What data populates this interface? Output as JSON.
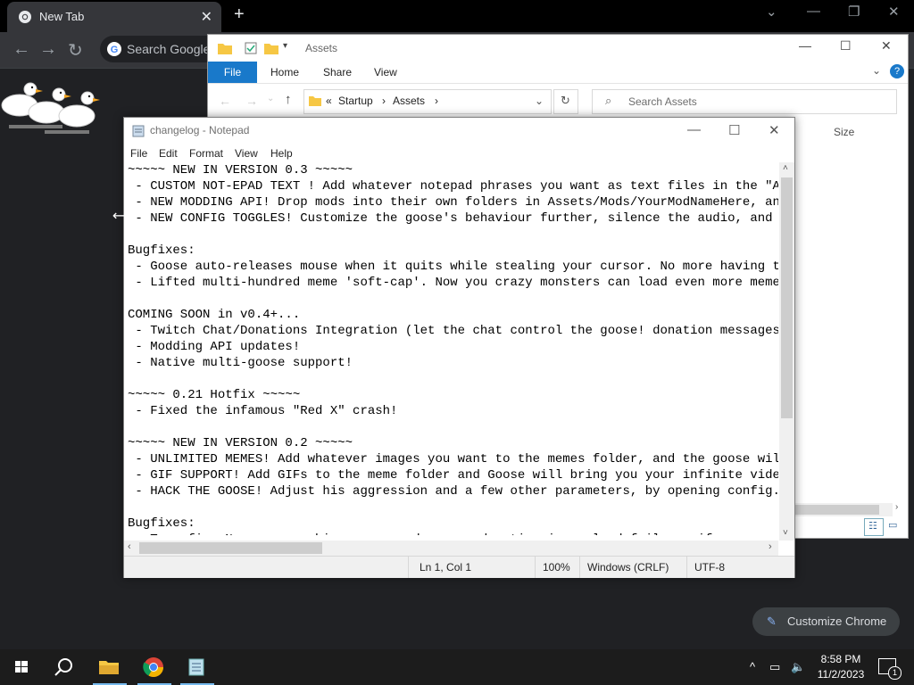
{
  "chrome": {
    "tab_title": "New Tab",
    "omnibox_placeholder": "Search Google",
    "customize_label": "Customize Chrome"
  },
  "explorer": {
    "title": "Assets",
    "ribbon_tabs": [
      "File",
      "Home",
      "Share",
      "View"
    ],
    "breadcrumb": [
      "Startup",
      "Assets"
    ],
    "search_placeholder": "Search Assets",
    "column_size": "Size"
  },
  "notepad": {
    "title": "changelog - Notepad",
    "menu": [
      "File",
      "Edit",
      "Format",
      "View",
      "Help"
    ],
    "lines": [
      "~~~~~ NEW IN VERSION 0.3 ~~~~~",
      " - CUSTOM NOT-EPAD TEXT ! Add whatever notepad phrases you want as text files in the \"Asset",
      " - NEW MODDING API! Drop mods into their own folders in Assets/Mods/YourModNameHere, and to",
      " - NEW CONFIG TOGGLES! Customize the goose's behaviour further, silence the audio, and more",
      "",
      "Bugfixes:",
      " - Goose auto-releases mouse when it quits while stealing your cursor. No more having to al",
      " - Lifted multi-hundred meme 'soft-cap'. Now you crazy monsters can load even more memes at",
      "",
      "COMING SOON in v0.4+...",
      " - Twitch Chat/Donations Integration (let the chat control the goose! donation messages!) w",
      " - Modding API updates!",
      " - Native multi-goose support!",
      "",
      "~~~~~ 0.21 Hotfix ~~~~~",
      " - Fixed the infamous \"Red X\" crash!",
      "",
      "~~~~~ NEW IN VERSION 0.2 ~~~~~",
      " - UNLIMITED MEMES! Add whatever images you want to the memes folder, and the goose will pu",
      " - GIF SUPPORT! Add GIFs to the meme folder and Goose will bring you your infinite video",
      " - HACK THE GOOSE! Adjust his aggression and a few other parameters, by opening config.goos",
      "",
      "Bugfixes:",
      " - Temp fix: No more crashing, on an edge-case donation image load failure, if you move the"
    ],
    "status": {
      "position": "Ln 1, Col 1",
      "zoom": "100%",
      "line_ending": "Windows (CRLF)",
      "encoding": "UTF-8"
    }
  },
  "taskbar": {
    "time": "8:58 PM",
    "date": "11/2/2023",
    "notification_count": "1"
  }
}
